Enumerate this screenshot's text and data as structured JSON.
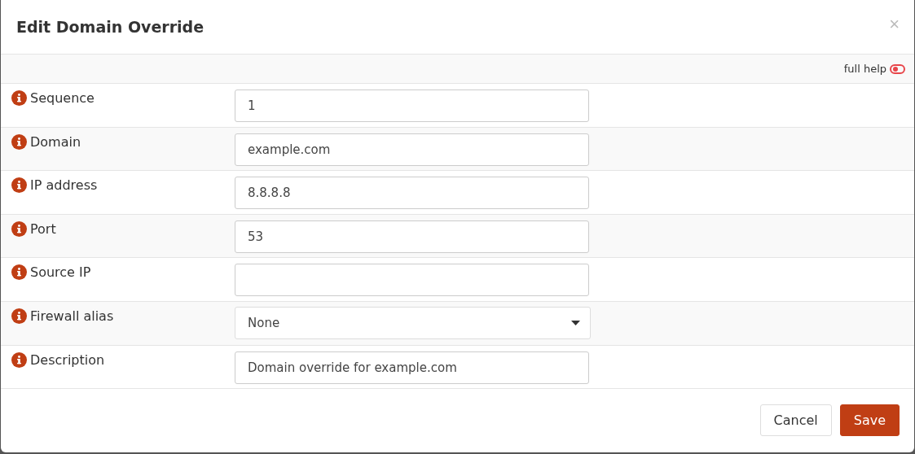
{
  "dialog": {
    "title": "Edit Domain Override",
    "close": "×"
  },
  "help_toggle": {
    "label": "full help",
    "on": false
  },
  "fields": [
    {
      "label": "Sequence",
      "kind": "text",
      "value": "1"
    },
    {
      "label": "Domain",
      "kind": "text",
      "value": "example.com"
    },
    {
      "label": "IP address",
      "kind": "text",
      "value": "8.8.8.8"
    },
    {
      "label": "Port",
      "kind": "text",
      "value": "53"
    },
    {
      "label": "Source IP",
      "kind": "text"
    },
    {
      "label": "Firewall alias",
      "kind": "select",
      "value": "None"
    },
    {
      "label": "Description",
      "kind": "text",
      "value": "Domain override for example.com"
    }
  ],
  "buttons": [
    {
      "label": "Cancel",
      "kind": "default"
    },
    {
      "label": "Save",
      "kind": "primary"
    }
  ]
}
